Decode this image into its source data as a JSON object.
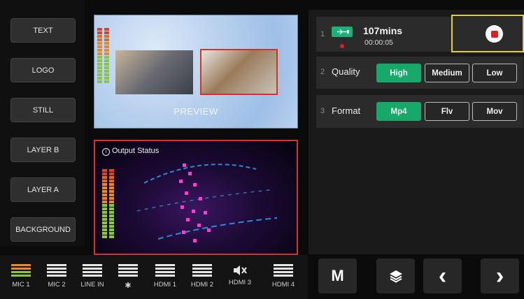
{
  "layers": [
    "TEXT",
    "LOGO",
    "STILL",
    "LAYER B",
    "LAYER A",
    "BACKGROUND"
  ],
  "preview": {
    "label": "PREVIEW"
  },
  "output": {
    "title": "Output Status",
    "icon": "info-icon"
  },
  "audio": {
    "channels": [
      {
        "label": "MIC 1",
        "icon": "fader-icon"
      },
      {
        "label": "MIC 2",
        "icon": "fader-icon"
      },
      {
        "label": "LINE IN",
        "icon": "fader-icon"
      },
      {
        "label": "✱",
        "icon": "bluetooth-icon"
      },
      {
        "label": "HDMI 1",
        "icon": "fader-icon"
      },
      {
        "label": "HDMI 2",
        "icon": "fader-icon"
      },
      {
        "label": "HDMI 3",
        "icon": "muted-speaker-icon"
      },
      {
        "label": "HDMI 4",
        "icon": "fader-icon"
      }
    ]
  },
  "storage": {
    "num": "1",
    "remaining": "107mins",
    "elapsed": "00:00:05",
    "icon": "usb-drive-icon"
  },
  "quality": {
    "num": "2",
    "label": "Quality",
    "options": [
      "High",
      "Medium",
      "Low"
    ],
    "selected": "High"
  },
  "format": {
    "num": "3",
    "label": "Format",
    "options": [
      "Mp4",
      "Flv",
      "Mov"
    ],
    "selected": "Mp4"
  },
  "nav": {
    "m_label": "M",
    "layers_icon": "layers-icon",
    "prev": "‹",
    "next": "›"
  },
  "colors": {
    "accent": "#16a96a",
    "record": "#e01f1f",
    "highlight": "#e7d21a",
    "output_border": "#d8302e"
  }
}
